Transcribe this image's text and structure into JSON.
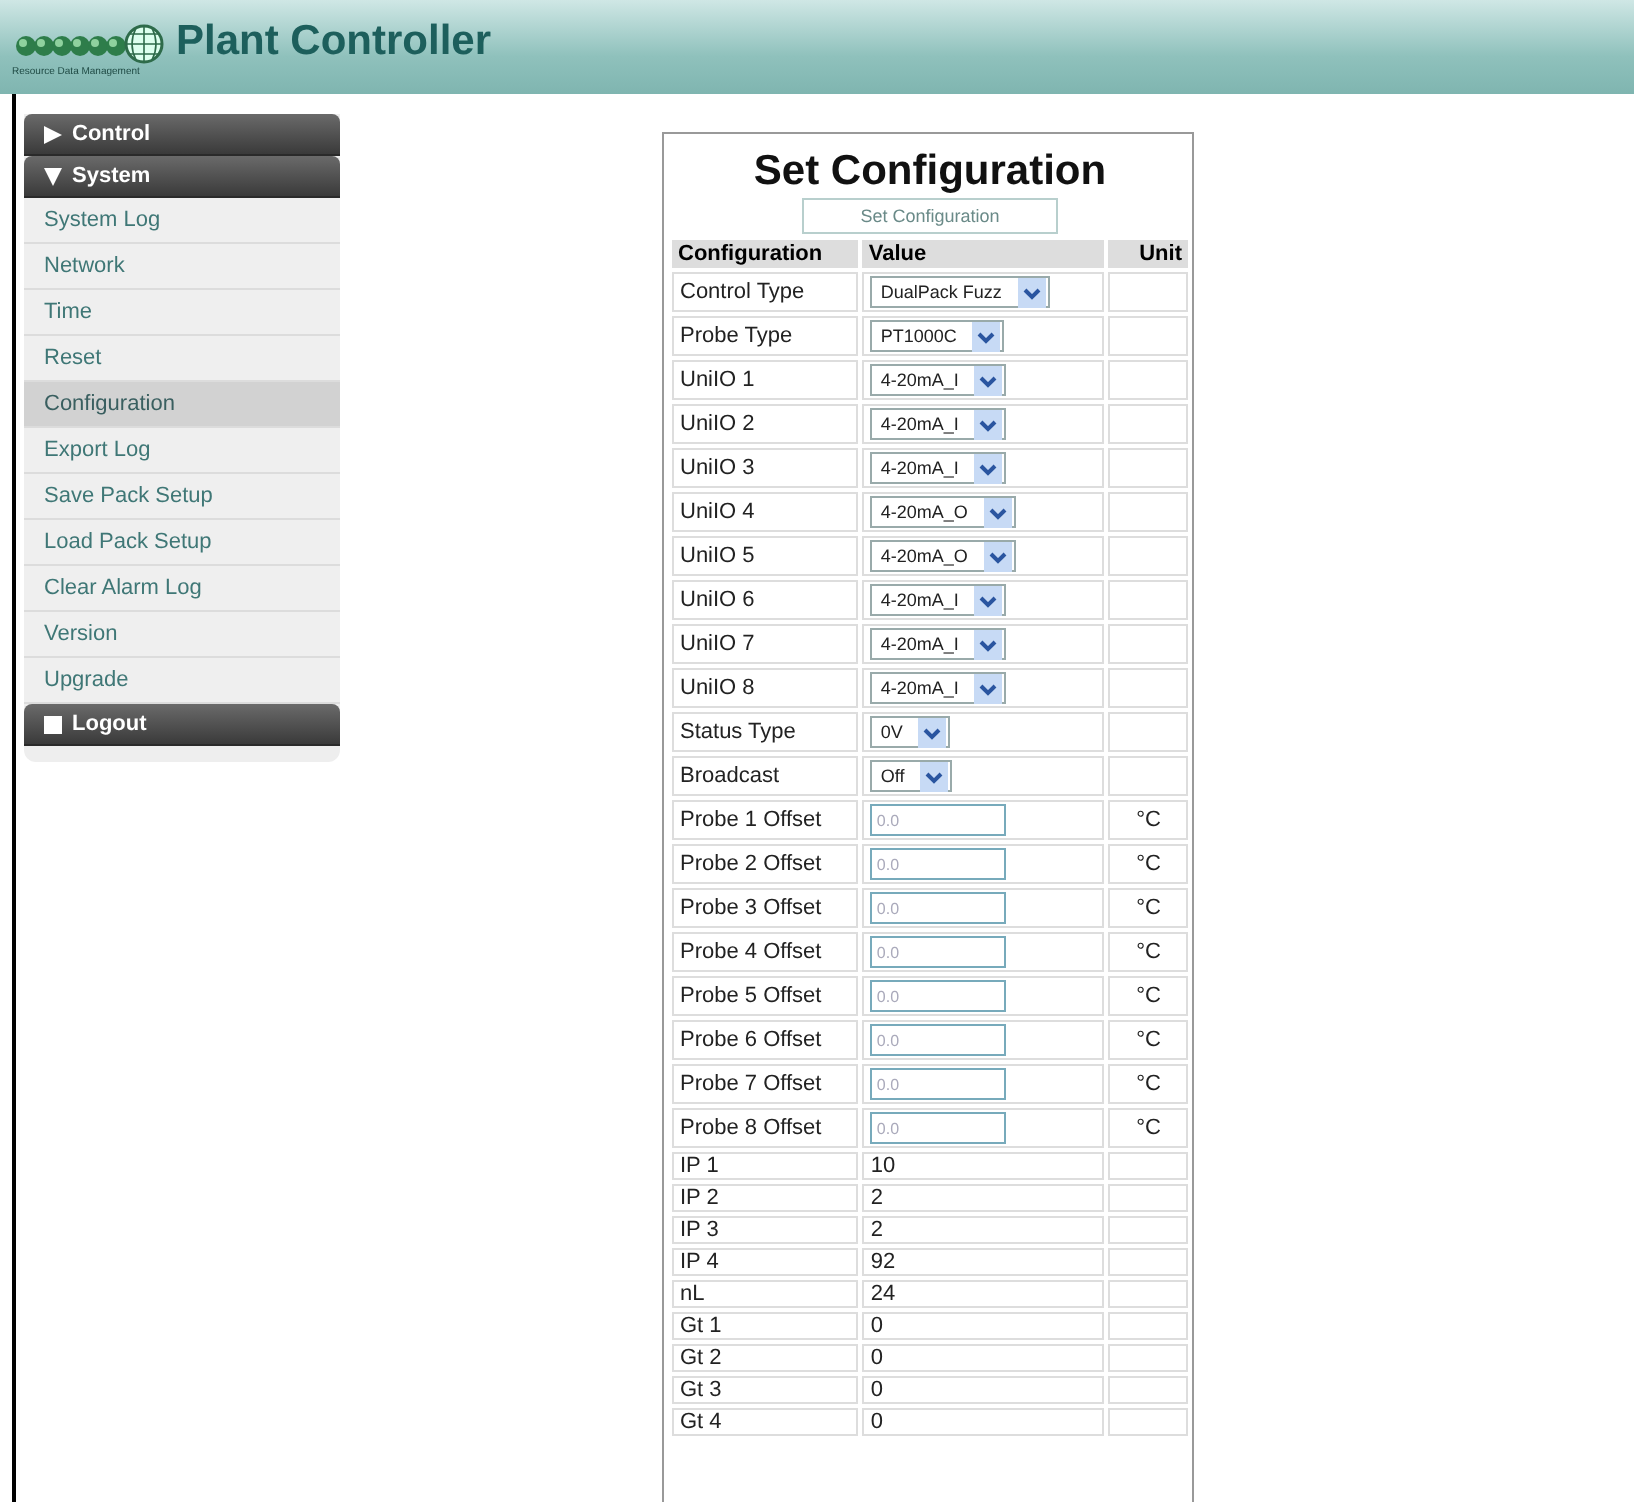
{
  "header": {
    "logo_caption": "Resource Data Management",
    "title": "Plant Controller"
  },
  "sidebar": {
    "sections": [
      {
        "label": "Control",
        "kind": "collapsed"
      },
      {
        "label": "System",
        "kind": "expanded",
        "items": [
          {
            "label": "System Log",
            "selected": false
          },
          {
            "label": "Network",
            "selected": false
          },
          {
            "label": "Time",
            "selected": false
          },
          {
            "label": "Reset",
            "selected": false
          },
          {
            "label": "Configuration",
            "selected": true
          },
          {
            "label": "Export Log",
            "selected": false
          },
          {
            "label": "Save Pack Setup",
            "selected": false
          },
          {
            "label": "Load Pack Setup",
            "selected": false
          },
          {
            "label": "Clear Alarm Log",
            "selected": false
          },
          {
            "label": "Version",
            "selected": false
          },
          {
            "label": "Upgrade",
            "selected": false
          }
        ]
      },
      {
        "label": "Logout",
        "kind": "action"
      }
    ]
  },
  "panel": {
    "title": "Set Configuration",
    "submit_button": "Set Configuration",
    "table": {
      "columns": [
        "Configuration",
        "Value",
        "Unit"
      ],
      "rows": [
        {
          "label": "Control Type",
          "kind": "select",
          "value": "DualPack Fuzz"
        },
        {
          "label": "Probe Type",
          "kind": "select",
          "value": "PT1000C"
        },
        {
          "label": "UniIO 1",
          "kind": "select",
          "value": "4-20mA_I"
        },
        {
          "label": "UniIO 2",
          "kind": "select",
          "value": "4-20mA_I"
        },
        {
          "label": "UniIO 3",
          "kind": "select",
          "value": "4-20mA_I"
        },
        {
          "label": "UniIO 4",
          "kind": "select",
          "value": "4-20mA_O"
        },
        {
          "label": "UniIO 5",
          "kind": "select",
          "value": "4-20mA_O"
        },
        {
          "label": "UniIO 6",
          "kind": "select",
          "value": "4-20mA_I"
        },
        {
          "label": "UniIO 7",
          "kind": "select",
          "value": "4-20mA_I"
        },
        {
          "label": "UniIO 8",
          "kind": "select",
          "value": "4-20mA_I"
        },
        {
          "label": "Status Type",
          "kind": "select",
          "value": "0V"
        },
        {
          "label": "Broadcast",
          "kind": "select",
          "value": "Off"
        },
        {
          "label": "Probe 1 Offset",
          "kind": "input",
          "placeholder": "0.0",
          "unit": "°C"
        },
        {
          "label": "Probe 2 Offset",
          "kind": "input",
          "placeholder": "0.0",
          "unit": "°C"
        },
        {
          "label": "Probe 3 Offset",
          "kind": "input",
          "placeholder": "0.0",
          "unit": "°C"
        },
        {
          "label": "Probe 4 Offset",
          "kind": "input",
          "placeholder": "0.0",
          "unit": "°C"
        },
        {
          "label": "Probe 5 Offset",
          "kind": "input",
          "placeholder": "0.0",
          "unit": "°C"
        },
        {
          "label": "Probe 6 Offset",
          "kind": "input",
          "placeholder": "0.0",
          "unit": "°C"
        },
        {
          "label": "Probe 7 Offset",
          "kind": "input",
          "placeholder": "0.0",
          "unit": "°C"
        },
        {
          "label": "Probe 8 Offset",
          "kind": "input",
          "placeholder": "0.0",
          "unit": "°C"
        },
        {
          "label": "IP 1",
          "kind": "text",
          "value": "10"
        },
        {
          "label": "IP 2",
          "kind": "text",
          "value": "2"
        },
        {
          "label": "IP 3",
          "kind": "text",
          "value": "2"
        },
        {
          "label": "IP 4",
          "kind": "text",
          "value": "92"
        },
        {
          "label": "nL",
          "kind": "text",
          "value": "24"
        },
        {
          "label": "Gt 1",
          "kind": "text",
          "value": "0"
        },
        {
          "label": "Gt 2",
          "kind": "text",
          "value": "0"
        },
        {
          "label": "Gt 3",
          "kind": "text",
          "value": "0"
        },
        {
          "label": "Gt 4",
          "kind": "text",
          "value": "0"
        }
      ]
    }
  }
}
